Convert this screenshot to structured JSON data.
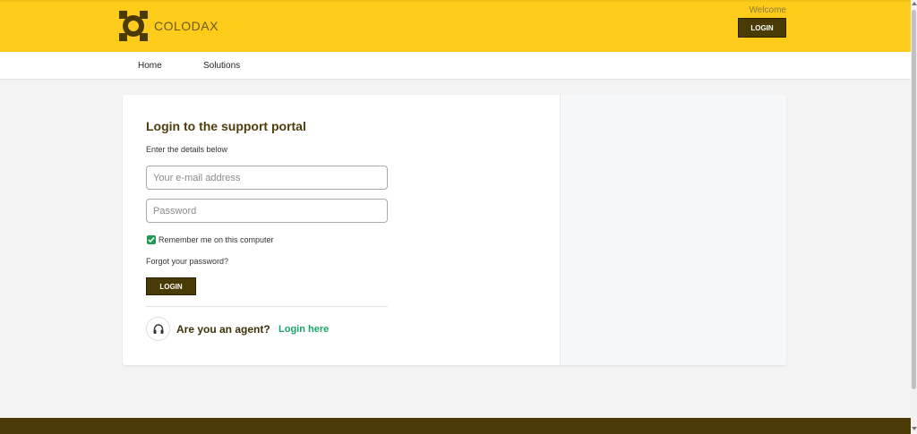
{
  "header": {
    "brand": "COLODAX",
    "welcome": "Welcome",
    "login_label": "LOGIN",
    "bg_color": "#fdcc1a"
  },
  "nav": {
    "items": [
      {
        "label": "Home"
      },
      {
        "label": "Solutions"
      }
    ]
  },
  "login": {
    "title": "Login to the support portal",
    "subtitle": "Enter the details below",
    "email_placeholder": "Your e-mail address",
    "password_placeholder": "Password",
    "remember_label": "Remember me on this computer",
    "remember_checked": true,
    "forgot_label": "Forgot your password?",
    "button_label": "LOGIN",
    "agent_question": "Are you an agent?",
    "agent_link": "Login here",
    "accent_color": "#1aa36a",
    "button_color": "#4a3a05"
  },
  "footer": {
    "bg_color": "#4a3a05"
  }
}
